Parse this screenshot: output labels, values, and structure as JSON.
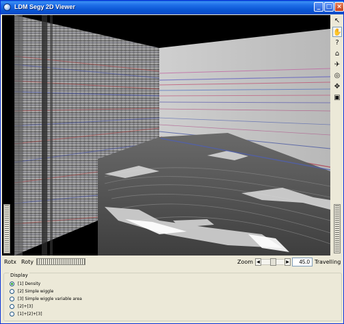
{
  "window": {
    "title": "LDM Segy 2D Viewer"
  },
  "titlebar": {
    "minimize": "_",
    "maximize": "□",
    "close": "×"
  },
  "toolbar": {
    "tools": [
      {
        "name": "pointer-icon",
        "glyph": "↖",
        "active": false
      },
      {
        "name": "hand-icon",
        "glyph": "✋",
        "active": true
      },
      {
        "name": "help-icon",
        "glyph": "?",
        "active": false
      },
      {
        "name": "home-icon",
        "glyph": "⌂",
        "active": false
      },
      {
        "name": "fly-icon",
        "glyph": "✈",
        "active": false
      },
      {
        "name": "perspective-icon",
        "glyph": "◎",
        "active": false
      },
      {
        "name": "center-icon",
        "glyph": "✥",
        "active": false
      },
      {
        "name": "view-all-icon",
        "glyph": "▣",
        "active": false
      }
    ]
  },
  "controls": {
    "rotx_label": "Rotx",
    "roty_label": "Roty",
    "zoom_label": "Zoom",
    "zoom_value": "45.0",
    "travelling_label": "Travelling"
  },
  "display": {
    "title": "Display",
    "options": [
      {
        "label": "[1] Density",
        "checked": true
      },
      {
        "label": "[2] Simple wiggle",
        "checked": false
      },
      {
        "label": "[3] Simple wiggle variable area",
        "checked": false
      },
      {
        "label": "[2]+[3]",
        "checked": false
      },
      {
        "label": "[1]+[2]+[3]",
        "checked": false
      }
    ]
  },
  "colors": {
    "titlebar": "#0a55d3",
    "seismic_red": "#c04040",
    "seismic_blue": "#4050b8",
    "background": "#ece9d8"
  }
}
